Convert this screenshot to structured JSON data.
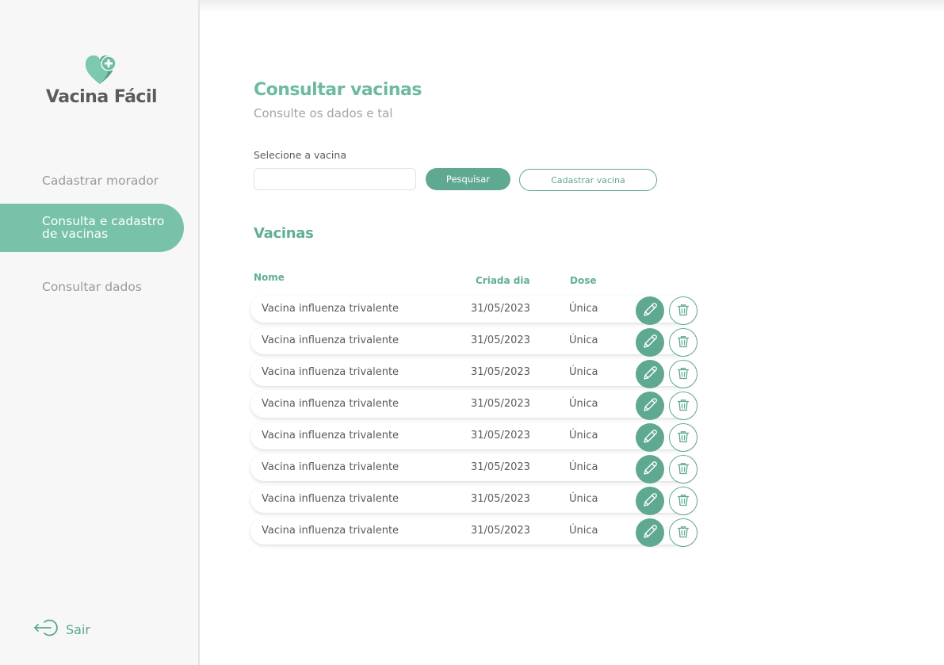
{
  "app": {
    "name": "Vacina Fácil"
  },
  "icons": {
    "logo": "heart-plus-icon",
    "logout": "logout-icon",
    "edit": "pencil-icon",
    "delete": "trash-icon"
  },
  "colors": {
    "accent": "#5fa891",
    "accent_light": "#77c2a8",
    "sidebar_bg": "#f7f7f7"
  },
  "sidebar": {
    "items": [
      {
        "label": "Cadastrar morador",
        "active": false
      },
      {
        "label": "Consulta e cadastro\nde  vacinas",
        "active": true
      },
      {
        "label": "Consultar dados",
        "active": false
      }
    ],
    "logout_label": "Sair"
  },
  "main": {
    "title": "Consultar vacinas",
    "subtitle": "Consulte os dados e tal",
    "search": {
      "label": "Selecione a vacina",
      "value": "",
      "placeholder": "",
      "search_button": "Pesquisar",
      "register_button": "Cadastrar vacina"
    },
    "table": {
      "title": "Vacinas",
      "columns": [
        "Nome",
        "Criada dia",
        "Dose"
      ],
      "rows": [
        {
          "name": "Vacina influenza trivalente",
          "date": "31/05/2023",
          "dose": "Única"
        },
        {
          "name": "Vacina influenza trivalente",
          "date": "31/05/2023",
          "dose": "Única"
        },
        {
          "name": "Vacina influenza trivalente",
          "date": "31/05/2023",
          "dose": "Única"
        },
        {
          "name": "Vacina influenza trivalente",
          "date": "31/05/2023",
          "dose": "Única"
        },
        {
          "name": "Vacina influenza trivalente",
          "date": "31/05/2023",
          "dose": "Única"
        },
        {
          "name": "Vacina influenza trivalente",
          "date": "31/05/2023",
          "dose": "Única"
        },
        {
          "name": "Vacina influenza trivalente",
          "date": "31/05/2023",
          "dose": "Única"
        },
        {
          "name": "Vacina influenza trivalente",
          "date": "31/05/2023",
          "dose": "Única"
        }
      ]
    }
  }
}
